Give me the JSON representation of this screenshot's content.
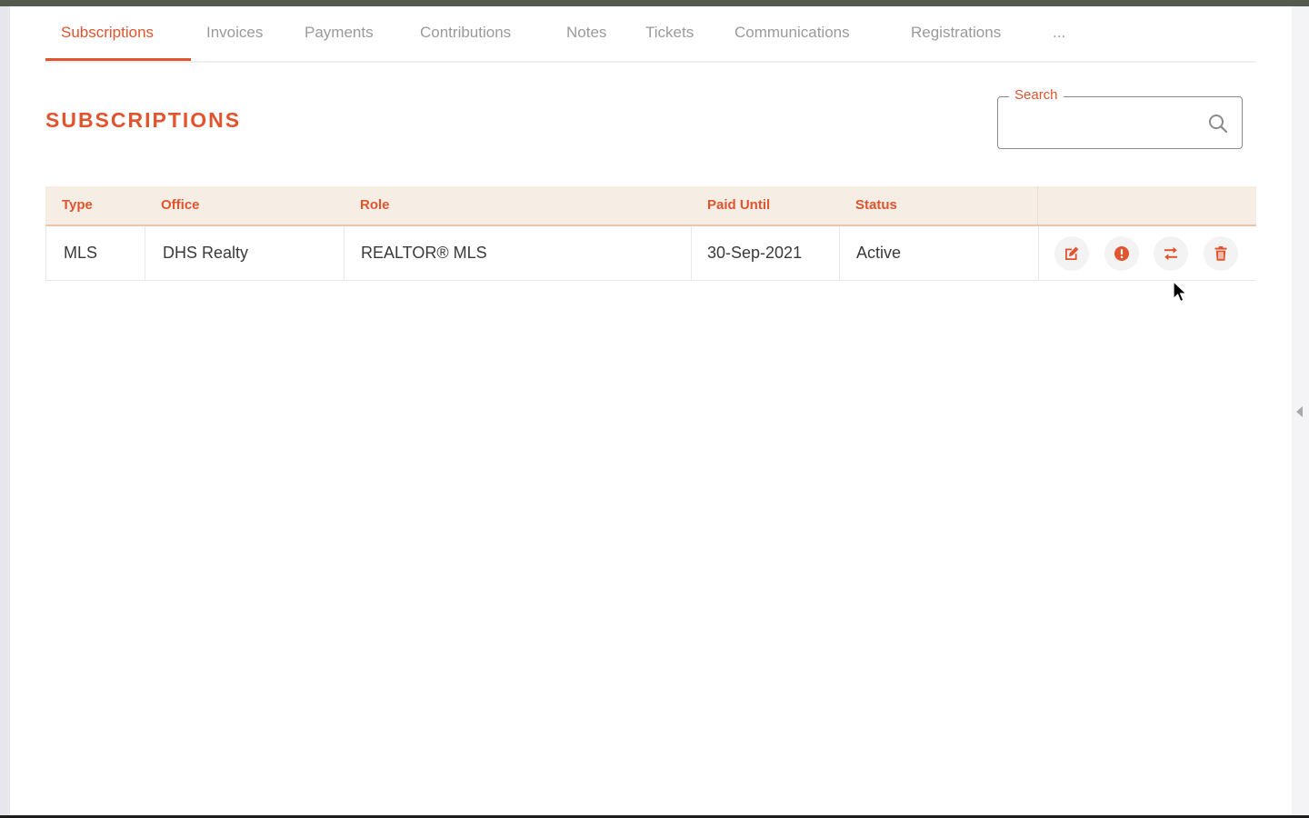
{
  "tabs": [
    {
      "label": "Subscriptions",
      "active": true
    },
    {
      "label": "Invoices"
    },
    {
      "label": "Payments"
    },
    {
      "label": "Contributions"
    },
    {
      "label": "Notes"
    },
    {
      "label": "Tickets"
    },
    {
      "label": "Communications"
    },
    {
      "label": "Registrations"
    },
    {
      "label": "..."
    }
  ],
  "page": {
    "title": "SUBSCRIPTIONS"
  },
  "search": {
    "label": "Search",
    "value": "",
    "icon": "search-icon"
  },
  "table": {
    "columns": [
      "Type",
      "Office",
      "Role",
      "Paid Until",
      "Status"
    ],
    "rows": [
      {
        "type": "MLS",
        "office": "DHS Realty",
        "role": "REALTOR® MLS",
        "paid_until": "30-Sep-2021",
        "status": "Active",
        "actions": [
          "edit-icon",
          "alert-icon",
          "swap-icon",
          "trash-icon"
        ]
      }
    ]
  },
  "colors": {
    "accent": "#e0542e",
    "header_bg": "#f6ede4",
    "top_bar": "#555a4f"
  }
}
